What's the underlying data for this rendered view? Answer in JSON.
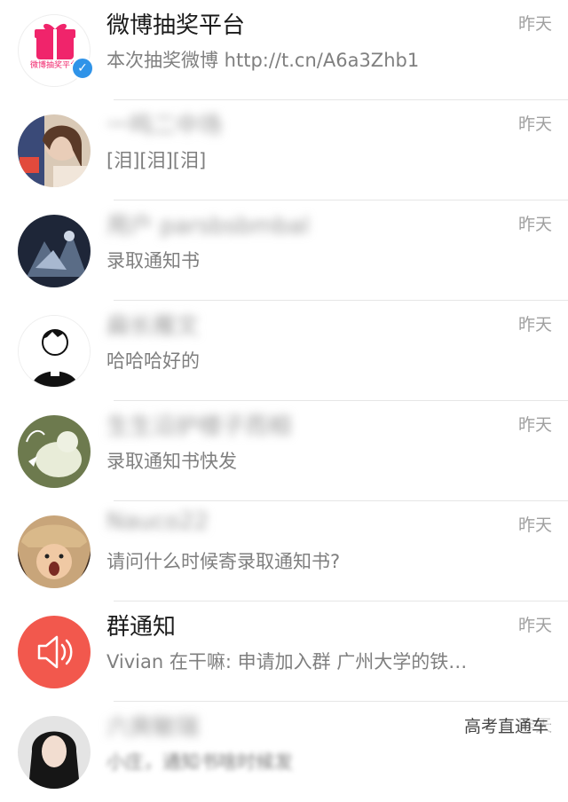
{
  "conversations": [
    {
      "name": "微博抽奖平台",
      "message": "本次抽奖微博 http://t.cn/A6a3Zhb1",
      "time": "昨天",
      "avatar_text": "微博抽奖平台"
    },
    {
      "name": "一鸣二中场",
      "message": "[泪][泪][泪]",
      "time": "昨天"
    },
    {
      "name": "用户 parsbsbmbal",
      "message": "录取通知书",
      "time": "昨天"
    },
    {
      "name": "扁长雁文",
      "message": "哈哈哈好的",
      "time": "昨天"
    },
    {
      "name": "生生沿护楼子而相",
      "message": "录取通知书快发",
      "time": "昨天"
    },
    {
      "name": "Nauco22",
      "message": "请问什么时候寄录取通知书?",
      "time": "昨天"
    },
    {
      "name": "群通知",
      "message": "Vivian 在干嘛: 申请加入群 广州大学的铁…",
      "time": "昨天"
    },
    {
      "name": "六爽敏瑞",
      "message": "小庄，通知书啥时候发",
      "time": "昨天"
    }
  ],
  "watermark": "高考直通车",
  "colors": {
    "accent_pink": "#f0246b",
    "notice_red": "#f2584d",
    "verified_blue": "#2f93e8"
  }
}
